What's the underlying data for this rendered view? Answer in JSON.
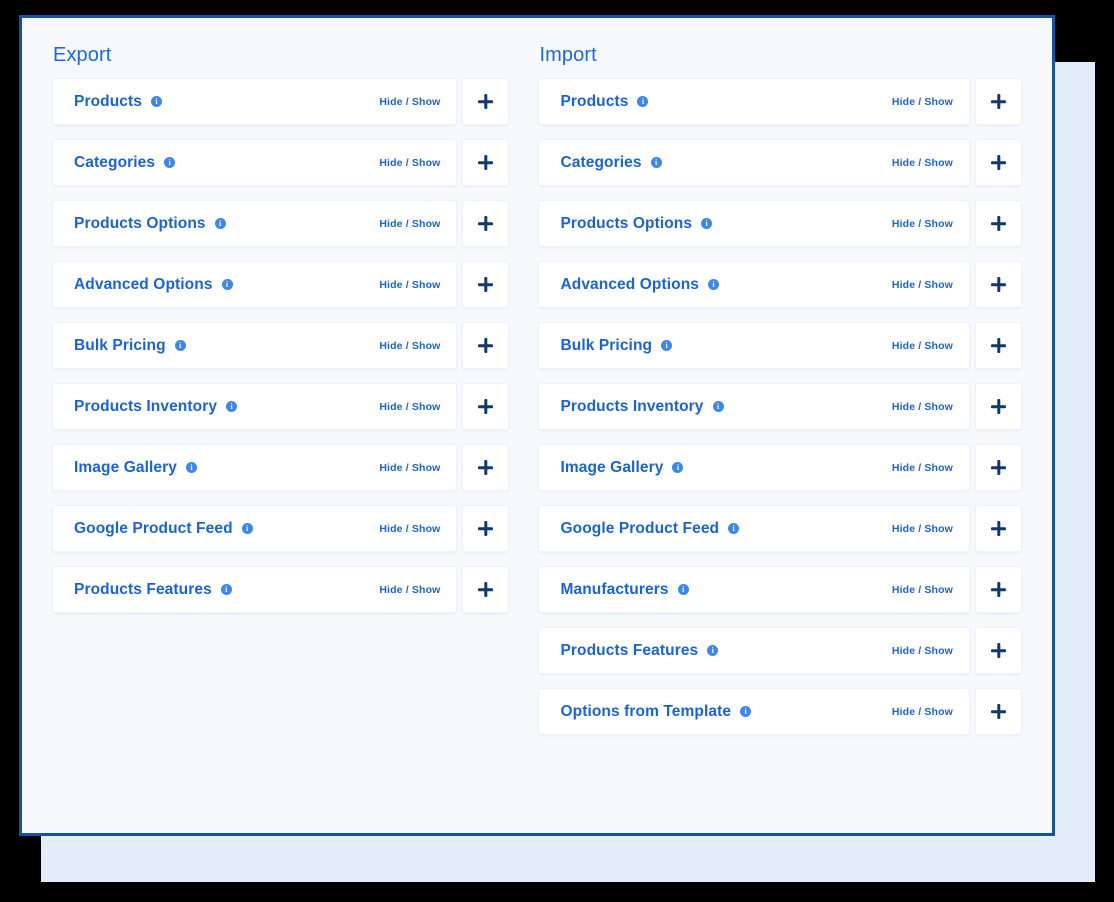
{
  "panel": {
    "columns": [
      {
        "key": "export",
        "title": "Export",
        "rows": [
          {
            "label": "Products",
            "info": "i",
            "toggle": "Hide / Show",
            "add": "+"
          },
          {
            "label": "Categories",
            "info": "i",
            "toggle": "Hide / Show",
            "add": "+"
          },
          {
            "label": "Products Options",
            "info": "i",
            "toggle": "Hide / Show",
            "add": "+"
          },
          {
            "label": "Advanced Options",
            "info": "i",
            "toggle": "Hide / Show",
            "add": "+"
          },
          {
            "label": "Bulk Pricing",
            "info": "i",
            "toggle": "Hide / Show",
            "add": "+"
          },
          {
            "label": "Products Inventory",
            "info": "i",
            "toggle": "Hide / Show",
            "add": "+"
          },
          {
            "label": "Image Gallery",
            "info": "i",
            "toggle": "Hide / Show",
            "add": "+"
          },
          {
            "label": "Google Product Feed",
            "info": "i",
            "toggle": "Hide / Show",
            "add": "+"
          },
          {
            "label": "Products Features",
            "info": "i",
            "toggle": "Hide / Show",
            "add": "+"
          }
        ]
      },
      {
        "key": "import",
        "title": "Import",
        "rows": [
          {
            "label": "Products",
            "info": "i",
            "toggle": "Hide / Show",
            "add": "+"
          },
          {
            "label": "Categories",
            "info": "i",
            "toggle": "Hide / Show",
            "add": "+"
          },
          {
            "label": "Products Options",
            "info": "i",
            "toggle": "Hide / Show",
            "add": "+"
          },
          {
            "label": "Advanced Options",
            "info": "i",
            "toggle": "Hide / Show",
            "add": "+"
          },
          {
            "label": "Bulk Pricing",
            "info": "i",
            "toggle": "Hide / Show",
            "add": "+"
          },
          {
            "label": "Products Inventory",
            "info": "i",
            "toggle": "Hide / Show",
            "add": "+"
          },
          {
            "label": "Image Gallery",
            "info": "i",
            "toggle": "Hide / Show",
            "add": "+"
          },
          {
            "label": "Google Product Feed",
            "info": "i",
            "toggle": "Hide / Show",
            "add": "+"
          },
          {
            "label": "Manufacturers",
            "info": "i",
            "toggle": "Hide / Show",
            "add": "+"
          },
          {
            "label": "Products Features",
            "info": "i",
            "toggle": "Hide / Show",
            "add": "+"
          },
          {
            "label": "Options from Template",
            "info": "i",
            "toggle": "Hide / Show",
            "add": "+"
          }
        ]
      }
    ]
  },
  "colors": {
    "page_background": "#000000",
    "panel_background": "#f7f9fd",
    "panel_border": "#1352a4",
    "offset_card": "#e3ecfb",
    "card_background": "#ffffff",
    "card_border": "#edf2fb",
    "label_blue": "#1a63d6",
    "title_blue": "#1b6ae0",
    "info_icon_blue": "#3d86f0",
    "plus_navy": "#11376e"
  }
}
